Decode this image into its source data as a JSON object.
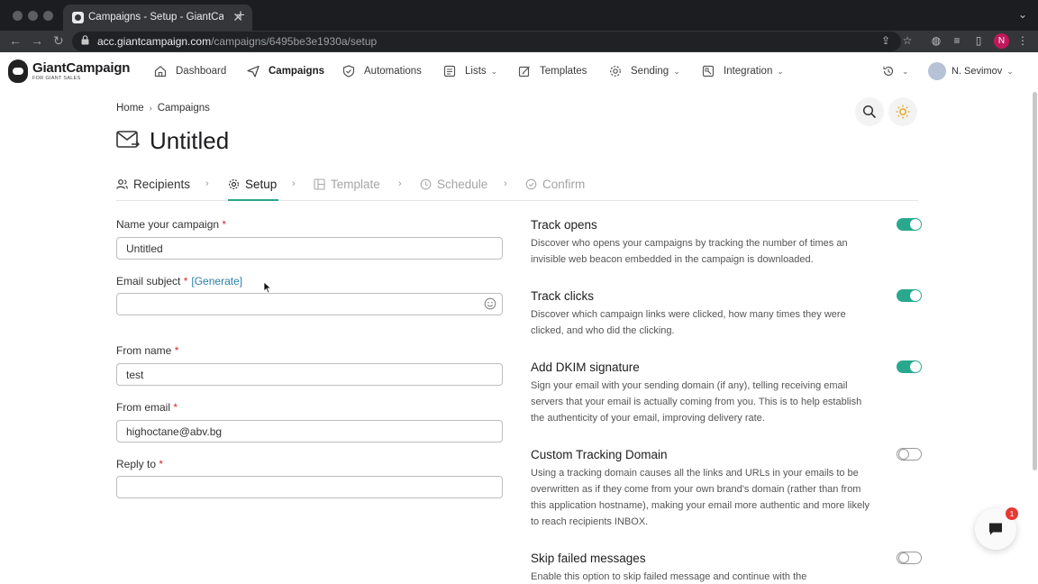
{
  "browser": {
    "tab_title": "Campaigns - Setup - GiantCam",
    "url_host": "acc.giantcampaign.com",
    "url_path": "/campaigns/6495be3e1930a/setup",
    "profile_initial": "N"
  },
  "app": {
    "logo_text": "GiantCampaign",
    "logo_subtext": "FOR GIANT SALES",
    "nav": {
      "dashboard": "Dashboard",
      "campaigns": "Campaigns",
      "automations": "Automations",
      "lists": "Lists",
      "templates": "Templates",
      "sending": "Sending",
      "integration": "Integration"
    },
    "user_name": "N. Sevimov"
  },
  "breadcrumb": {
    "home": "Home",
    "current": "Campaigns"
  },
  "page_title": "Untitled",
  "steps": {
    "recipients": "Recipients",
    "setup": "Setup",
    "template": "Template",
    "schedule": "Schedule",
    "confirm": "Confirm"
  },
  "form": {
    "campaign_name_label": "Name your campaign",
    "campaign_name_value": "Untitled",
    "subject_label": "Email subject",
    "generate_link": "[Generate]",
    "subject_value": "",
    "from_name_label": "From name",
    "from_name_value": "test",
    "from_email_label": "From email",
    "from_email_value": "highoctane@abv.bg",
    "reply_to_label": "Reply to",
    "reply_to_value": "",
    "required_mark": "*"
  },
  "options": [
    {
      "title": "Track opens",
      "desc": "Discover who opens your campaigns by tracking the number of times an invisible web beacon embedded in the campaign is downloaded.",
      "enabled": true
    },
    {
      "title": "Track clicks",
      "desc": "Discover which campaign links were clicked, how many times they were clicked, and who did the clicking.",
      "enabled": true
    },
    {
      "title": "Add DKIM signature",
      "desc": "Sign your email with your sending domain (if any), telling receiving email servers that your email is actually coming from you. This is to help establish the authenticity of your email, improving delivery rate.",
      "enabled": true
    },
    {
      "title": "Custom Tracking Domain",
      "desc": "Using a tracking domain causes all the links and URLs in your emails to be overwritten as if they come from your own brand's domain (rather than from this application hostname), making your email more authentic and more likely to reach recipients INBOX.",
      "enabled": false
    },
    {
      "title": "Skip failed messages",
      "desc": "Enable this option to skip failed message and continue with the",
      "enabled": false
    }
  ],
  "chat": {
    "badge": "1"
  },
  "colors": {
    "accent": "#2aa88e",
    "link": "#2a7fa8",
    "required": "#d12d2d"
  }
}
